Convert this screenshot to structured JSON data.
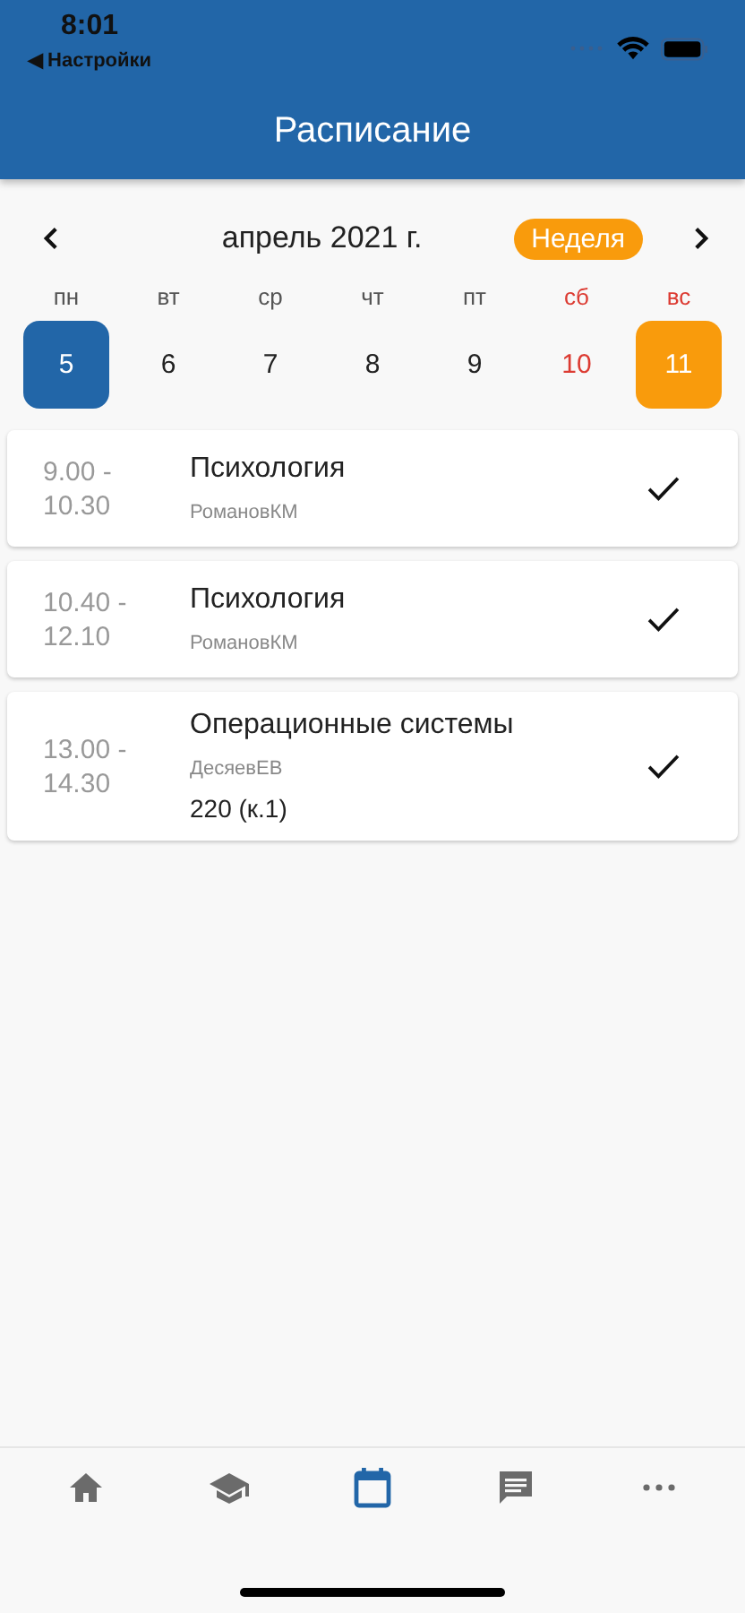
{
  "status_bar": {
    "time": "8:01",
    "back_link": "◀ Настройки"
  },
  "header": {
    "title": "Расписание"
  },
  "calendar": {
    "month": "апрель 2021 г.",
    "view_button": "Неделя",
    "days": [
      {
        "weekday": "пн",
        "number": "5",
        "selected": true,
        "today": false,
        "weekend": false
      },
      {
        "weekday": "вт",
        "number": "6",
        "selected": false,
        "today": false,
        "weekend": false
      },
      {
        "weekday": "ср",
        "number": "7",
        "selected": false,
        "today": false,
        "weekend": false
      },
      {
        "weekday": "чт",
        "number": "8",
        "selected": false,
        "today": false,
        "weekend": false
      },
      {
        "weekday": "пт",
        "number": "9",
        "selected": false,
        "today": false,
        "weekend": false
      },
      {
        "weekday": "сб",
        "number": "10",
        "selected": false,
        "today": false,
        "weekend": true
      },
      {
        "weekday": "вс",
        "number": "11",
        "selected": false,
        "today": true,
        "weekend": true
      }
    ]
  },
  "lessons": [
    {
      "time": "9.00 - 10.30",
      "subject": "Психология",
      "teacher": "РомановКМ",
      "done": true
    },
    {
      "time": "10.40 - 12.10",
      "subject": "Психология",
      "teacher": "РомановКМ",
      "done": true
    },
    {
      "time": "13.00 - 14.30",
      "subject": "Операционные системы",
      "teacher": "ДесяевЕВ",
      "room": "220 (к.1)",
      "done": true
    }
  ],
  "tab_bar": [
    {
      "kind": "home",
      "selected": false
    },
    {
      "kind": "courses",
      "selected": false
    },
    {
      "kind": "schedule",
      "selected": true
    },
    {
      "kind": "messages",
      "selected": false
    },
    {
      "kind": "more",
      "selected": false
    }
  ]
}
